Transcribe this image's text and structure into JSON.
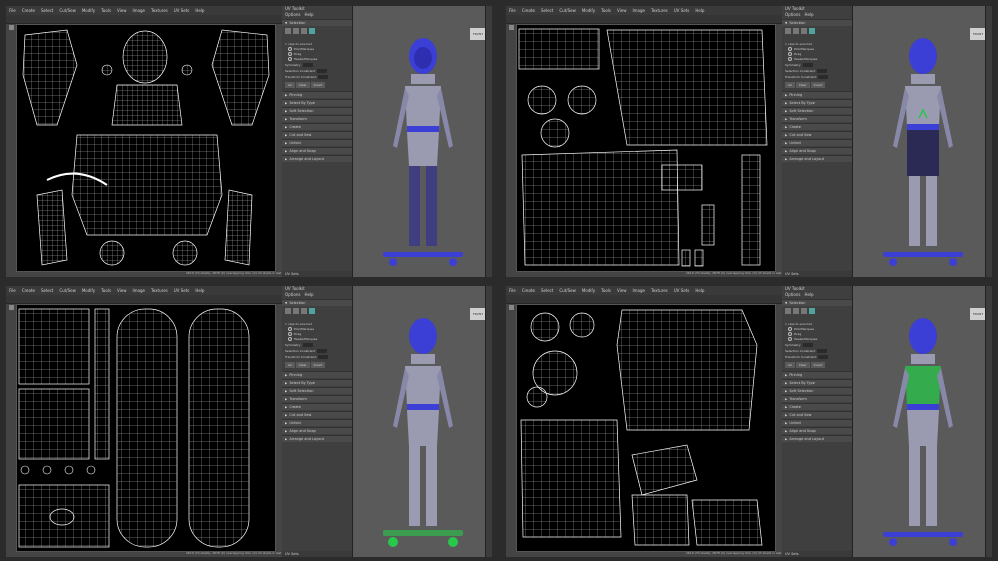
{
  "uv_editor": {
    "menu": [
      "File",
      "Create",
      "Select",
      "Cut/Sew",
      "Modify",
      "Tools",
      "View",
      "Image",
      "Textures",
      "UV Sets",
      "Help"
    ],
    "status_text": "2610 (70 shells), 2878 (0) overlapping UVs, (0) UV shells in last (0/0)"
  },
  "toolkit": {
    "title": "UV Toolkit",
    "menu": [
      "Options",
      "Help"
    ],
    "selection_header": "Selection",
    "objects_selected": "1 objects selected",
    "pick_options": [
      "Pick/Marquee",
      "Drag",
      "Tweak/Marquee"
    ],
    "symmetry_label": "Symmetry",
    "symmetry_value": "Off",
    "selection_constraint_label": "Selection Constraint",
    "selection_constraint_value": "Off",
    "transform_constraint_label": "Transform Constraint",
    "transform_constraint_value": "Off",
    "buttons": [
      "All",
      "Clear",
      "Invert"
    ],
    "sections": [
      "Pinning",
      "Select By Type",
      "Soft Selection",
      "Transform",
      "Create",
      "Cut and Sew",
      "Unfold",
      "Align and Snap",
      "Arrange and Layout"
    ],
    "footer": "UV Sets"
  },
  "viewport": {
    "cube_label": "FRONT"
  },
  "colors": {
    "mesh_blue": "#3b3fd6",
    "mesh_grey": "#9a9ab0",
    "selection_green": "#28c84a",
    "uv_background": "#000000"
  }
}
